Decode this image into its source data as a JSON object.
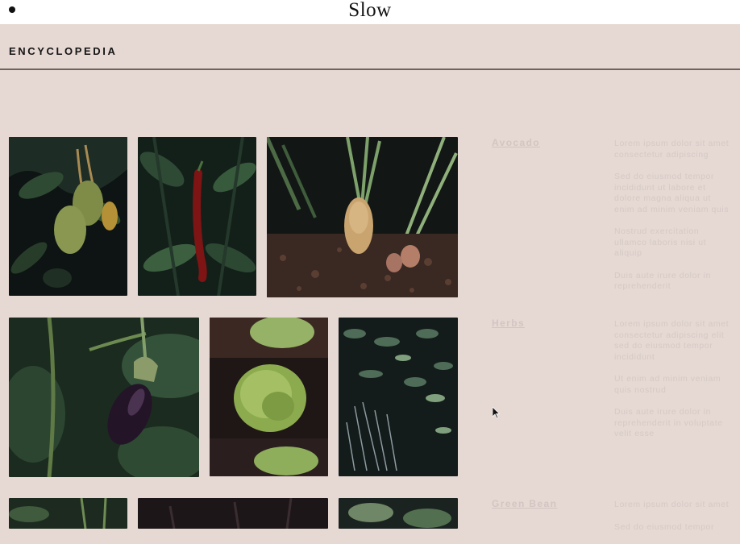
{
  "brand": {
    "name": "Slow"
  },
  "section": {
    "title": "ENCYCLOPEDIA"
  },
  "gallery": [
    {
      "subject": "avocado",
      "icon": "avocado-photo"
    },
    {
      "subject": "chili-pepper",
      "icon": "chili-pepper-photo"
    },
    {
      "subject": "radish",
      "icon": "radish-photo"
    },
    {
      "subject": "eggplant",
      "icon": "eggplant-photo"
    },
    {
      "subject": "lettuce",
      "icon": "lettuce-photo"
    },
    {
      "subject": "herbs",
      "icon": "herbs-photo"
    },
    {
      "subject": "plant",
      "icon": "plant-photo"
    },
    {
      "subject": "dark-plant",
      "icon": "dark-plant-photo"
    },
    {
      "subject": "leaves",
      "icon": "leaves-photo"
    }
  ],
  "categories": [
    {
      "label": "Avocado",
      "notes": [
        "Lorem ipsum dolor sit amet consectetur adipiscing",
        "Sed do eiusmod tempor incididunt ut labore et dolore magna aliqua ut enim ad minim veniam quis",
        "Nostrud exercitation ullamco laboris nisi ut aliquip",
        "Duis aute irure dolor in reprehenderit"
      ]
    },
    {
      "label": "Herbs",
      "notes": [
        "Lorem ipsum dolor sit amet consectetur adipiscing elit sed do eiusmod tempor incididunt",
        "Ut enim ad minim veniam quis nostrud",
        "Duis aute irure dolor in reprehenderit in voluptate velit esse"
      ]
    },
    {
      "label": "Green Bean",
      "notes": [
        "Lorem ipsum dolor sit amet",
        "Sed do eiusmod tempor"
      ]
    }
  ],
  "colors": {
    "background": "#e6d8d3",
    "topbar": "#ffffff",
    "text": "#151515"
  }
}
